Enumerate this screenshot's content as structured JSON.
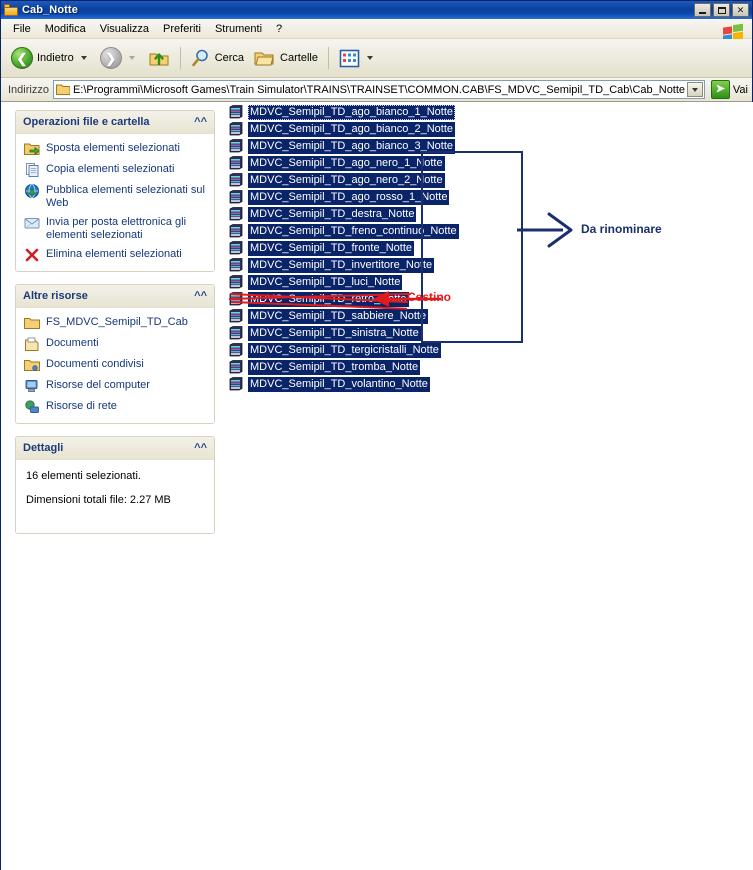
{
  "window": {
    "title": "Cab_Notte",
    "icon": "folder-icon",
    "buttons": {
      "minimize": "minimize-button",
      "maximize": "maximize-button",
      "close": "✕"
    }
  },
  "menubar": {
    "items": [
      {
        "label": "File",
        "name": "menu-file"
      },
      {
        "label": "Modifica",
        "name": "menu-modifica"
      },
      {
        "label": "Visualizza",
        "name": "menu-visualizza"
      },
      {
        "label": "Preferiti",
        "name": "menu-preferiti"
      },
      {
        "label": "Strumenti",
        "name": "menu-strumenti"
      },
      {
        "label": "?",
        "name": "menu-help"
      }
    ],
    "logo": "windows-flag-icon"
  },
  "toolbar": {
    "back_label": "Indietro",
    "forward_label": "",
    "up_label": "",
    "search_label": "Cerca",
    "folders_label": "Cartelle",
    "views_label": ""
  },
  "address": {
    "label": "Indirizzo",
    "path": "E:\\Programmi\\Microsoft Games\\Train Simulator\\TRAINS\\TRAINSET\\COMMON.CAB\\FS_MDVC_Semipil_TD_Cab\\Cab_Notte",
    "go_label": "Vai"
  },
  "taskpane": {
    "panels": [
      {
        "title": "Operazioni file e cartella",
        "name": "panel-file-folder-tasks",
        "items": [
          {
            "label": "Sposta elementi selezionati",
            "icon": "move-icon"
          },
          {
            "label": "Copia elementi selezionati",
            "icon": "copy-icon"
          },
          {
            "label": "Pubblica elementi selezionati sul Web",
            "icon": "publish-web-icon"
          },
          {
            "label": "Invia per posta elettronica gli elementi selezionati",
            "icon": "email-icon"
          },
          {
            "label": "Elimina elementi selezionati",
            "icon": "delete-icon"
          }
        ]
      },
      {
        "title": "Altre risorse",
        "name": "panel-other-places",
        "items": [
          {
            "label": "FS_MDVC_Semipil_TD_Cab",
            "icon": "folder-icon"
          },
          {
            "label": "Documenti",
            "icon": "documents-icon"
          },
          {
            "label": "Documenti condivisi",
            "icon": "shared-documents-icon"
          },
          {
            "label": "Risorse del computer",
            "icon": "my-computer-icon"
          },
          {
            "label": "Risorse di rete",
            "icon": "network-icon"
          }
        ]
      },
      {
        "title": "Dettagli",
        "name": "panel-details",
        "lines": [
          "16 elementi selezionati.",
          "Dimensioni totali file: 2.27 MB"
        ]
      }
    ]
  },
  "filelist": {
    "icon": "ace-file-icon",
    "files": [
      {
        "name": "MDVC_Semipil_TD_ago_bianco_1_Notte",
        "focused": true,
        "struck": false
      },
      {
        "name": "MDVC_Semipil_TD_ago_bianco_2_Notte",
        "focused": false,
        "struck": false
      },
      {
        "name": "MDVC_Semipil_TD_ago_bianco_3_Notte",
        "focused": false,
        "struck": false
      },
      {
        "name": "MDVC_Semipil_TD_ago_nero_1_Notte",
        "focused": false,
        "struck": false
      },
      {
        "name": "MDVC_Semipil_TD_ago_nero_2_Notte",
        "focused": false,
        "struck": false
      },
      {
        "name": "MDVC_Semipil_TD_ago_rosso_1_Notte",
        "focused": false,
        "struck": false
      },
      {
        "name": "MDVC_Semipil_TD_destra_Notte",
        "focused": false,
        "struck": false
      },
      {
        "name": "MDVC_Semipil_TD_freno_continuo_Notte",
        "focused": false,
        "struck": false
      },
      {
        "name": "MDVC_Semipil_TD_fronte_Notte",
        "focused": false,
        "struck": false
      },
      {
        "name": "MDVC_Semipil_TD_invertitore_Notte",
        "focused": false,
        "struck": false
      },
      {
        "name": "MDVC_Semipil_TD_luci_Notte",
        "focused": false,
        "struck": false
      },
      {
        "name": "MDVC_Semipil_TD_retro_Notte",
        "focused": false,
        "struck": true
      },
      {
        "name": "MDVC_Semipil_TD_sabbiere_Notte",
        "focused": false,
        "struck": false
      },
      {
        "name": "MDVC_Semipil_TD_sinistra_Notte",
        "focused": false,
        "struck": false
      },
      {
        "name": "MDVC_Semipil_TD_tergicristalli_Notte",
        "focused": false,
        "struck": false
      },
      {
        "name": "MDVC_Semipil_TD_tromba_Notte",
        "focused": false,
        "struck": false
      },
      {
        "name": "MDVC_Semipil_TD_volantino_Notte",
        "focused": false,
        "struck": false
      }
    ]
  },
  "annotations": {
    "rename_label": "Da rinominare",
    "rename_color": "#1b2f6e",
    "trash_label": "Cestino",
    "trash_color": "#e01b1b"
  },
  "colors": {
    "selection": "#0a246a",
    "titlebar": "#0a3f9c",
    "panel_header": "#e7e4d2",
    "panel_title_text": "#1c3a7a",
    "task_link": "#15387a"
  }
}
